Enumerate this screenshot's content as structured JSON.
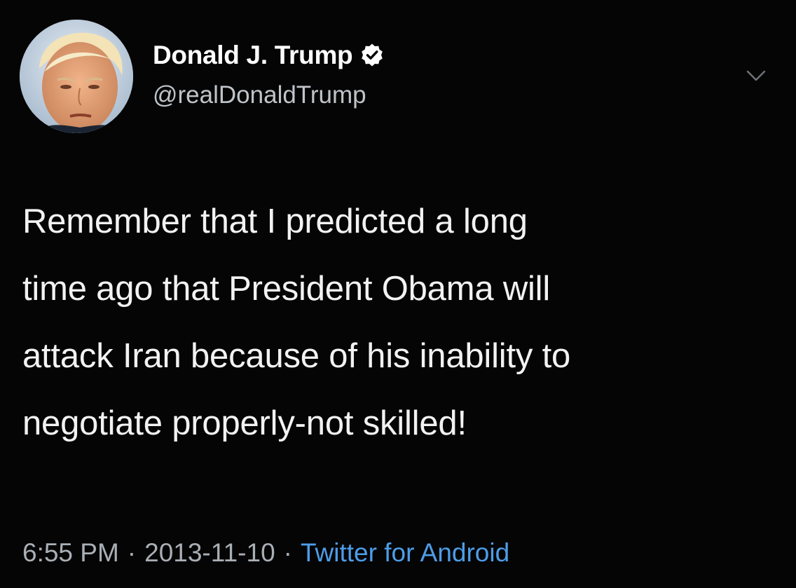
{
  "user": {
    "display_name": "Donald J. Trump",
    "handle": "@realDonaldTrump",
    "verified": true,
    "avatar_icon": "profile-photo"
  },
  "tweet": {
    "lines": [
      "Remember that I predicted a long",
      "time ago that President Obama will",
      "attack Iran because of his inability to",
      "negotiate properly-not skilled!"
    ]
  },
  "meta": {
    "time": "6:55 PM",
    "separator": "·",
    "date": "2013-11-10",
    "source": "Twitter for Android"
  },
  "colors": {
    "background": "#050505",
    "text": "#f2f2f2",
    "secondary": "#a9afb5",
    "link": "#4d9de8"
  },
  "icons": {
    "verified": "verified-badge-icon",
    "caret": "chevron-down-icon"
  }
}
